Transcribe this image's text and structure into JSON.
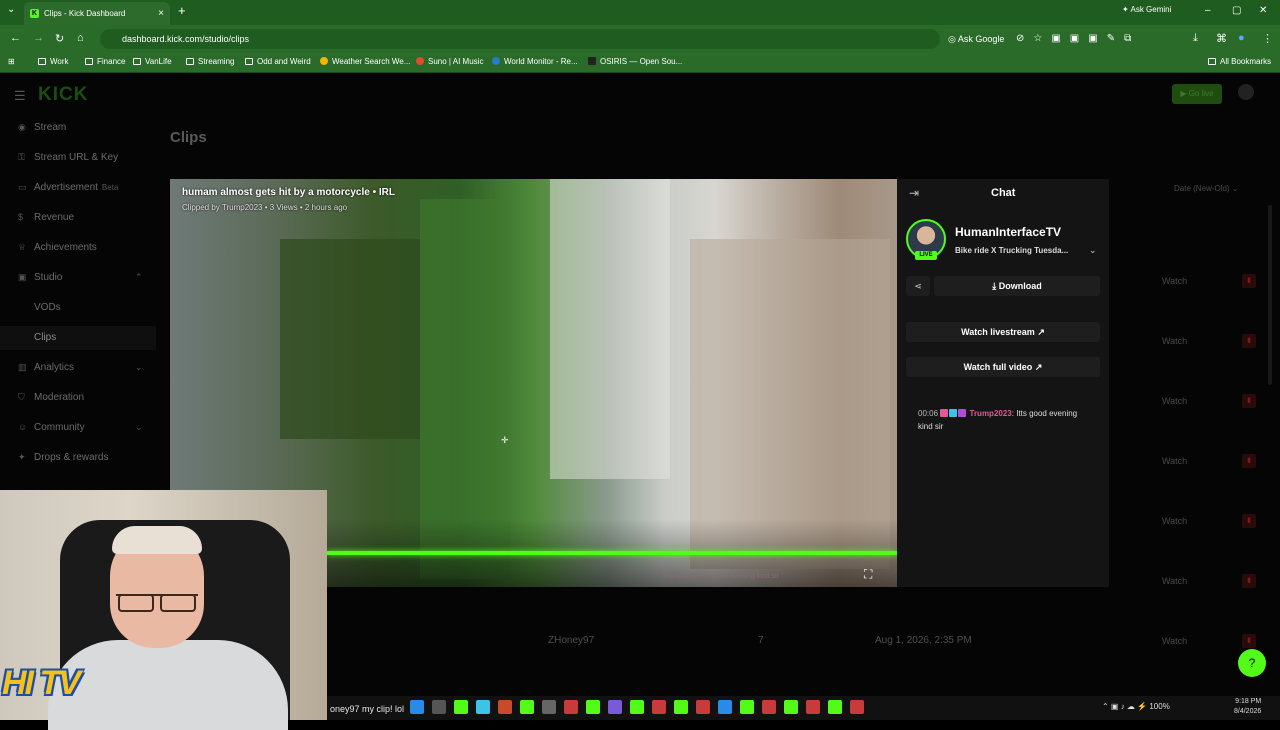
{
  "browser": {
    "tab_title": "Clips - Kick Dashboard",
    "tab_favicon": "K",
    "url": "dashboard.kick.com/studio/clips",
    "ask_google": "Ask Google",
    "ask_gemini": "Ask Gemini",
    "bookmarks": [
      "Work",
      "Finance",
      "VanLife",
      "Streaming",
      "Odd and Weird",
      "Weather Search We...",
      "Suno | AI Music",
      "World Monitor - Re...",
      "OSIRIS — Open Sou..."
    ],
    "all_bookmarks": "All Bookmarks"
  },
  "header": {
    "logo": "KICK",
    "go_live": "Go live"
  },
  "sidebar": {
    "items": [
      {
        "label": "Stream",
        "icon": "stream-icon"
      },
      {
        "label": "Stream URL & Key",
        "icon": "key-icon"
      },
      {
        "label": "Advertisement",
        "badge": "Beta",
        "icon": "ad-icon"
      },
      {
        "label": "Revenue",
        "icon": "dollar-icon"
      },
      {
        "label": "Achievements",
        "icon": "trophy-icon"
      },
      {
        "label": "Studio",
        "icon": "studio-icon"
      },
      {
        "label": "VODs",
        "icon": ""
      },
      {
        "label": "Clips",
        "icon": ""
      },
      {
        "label": "Analytics",
        "icon": "chart-icon"
      },
      {
        "label": "Moderation",
        "icon": "shield-icon"
      },
      {
        "label": "Community",
        "icon": "users-icon"
      },
      {
        "label": "Drops & rewards",
        "icon": "gift-icon"
      }
    ]
  },
  "main": {
    "title": "Clips",
    "sort": "Date (New-Old)",
    "watch_label": "Watch",
    "row_visible": {
      "creator": "ZHoney97",
      "views": "7",
      "date": "Aug 1, 2026, 2:35 PM"
    }
  },
  "video": {
    "title": "humam almost gets hit by a motorcycle • IRL",
    "meta": "Clipped by Trump2023 • 3 Views • 2 hours ago",
    "overlay_chat": "Trump2023: Itts good evening kind sir",
    "progress": 1.0
  },
  "chat": {
    "header": "Chat",
    "channel": "HumanInterfaceTV",
    "stream_title": "Bike ride X Trucking Tuesda...",
    "live": "LIVE",
    "download": "Download",
    "watch_livestream": "Watch livestream",
    "watch_full_video": "Watch full video",
    "message": {
      "time": "00:06",
      "user": "Trump2023",
      "text": ": Itts good evening kind sir"
    }
  },
  "overlay": {
    "logo_text": "HI TV",
    "taskbar_scroll": "oney97 my clip! lol",
    "clock_time": "9:18 PM",
    "clock_date": "8/4/2026",
    "battery": "100%"
  }
}
